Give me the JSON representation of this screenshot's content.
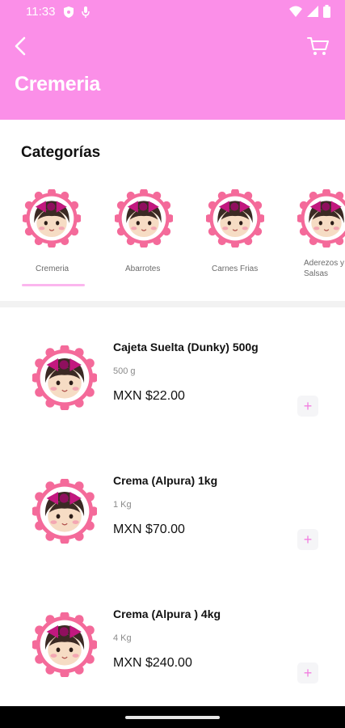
{
  "status": {
    "time": "11:33"
  },
  "header": {
    "title": "Cremeria"
  },
  "categories": {
    "title": "Categorías",
    "items": [
      {
        "label": "Cremeria"
      },
      {
        "label": "Abarrotes"
      },
      {
        "label": "Carnes Frias"
      },
      {
        "label": "Aderezos y Salsas"
      }
    ]
  },
  "products": [
    {
      "name": "Cajeta Suelta (Dunky) 500g",
      "unit": "500 g",
      "price": "MXN $22.00"
    },
    {
      "name": "Crema (Alpura) 1kg",
      "unit": "1 Kg",
      "price": "MXN $70.00"
    },
    {
      "name": "Crema (Alpura ) 4kg",
      "unit": "4 Kg",
      "price": "MXN $240.00"
    }
  ],
  "icons": {
    "back": "back-arrow-icon",
    "cart": "cart-icon",
    "add": "plus-icon"
  },
  "colors": {
    "header": "#fb8fe8",
    "accent": "#f27fe0",
    "logo_scallop": "#f46a9a",
    "logo_bow": "#c2187f"
  }
}
